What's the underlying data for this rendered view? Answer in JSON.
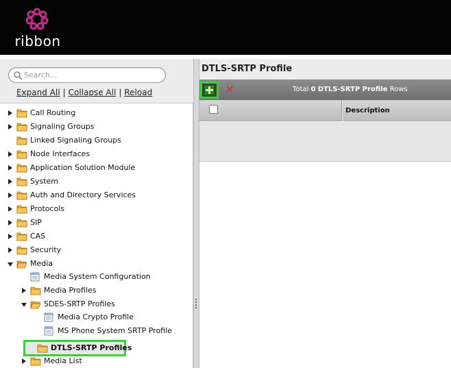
{
  "brand": {
    "name": "ribbon",
    "accent": "#9b2a8f"
  },
  "left": {
    "search": {
      "placeholder": "Search..."
    },
    "links": {
      "expand": "Expand All",
      "collapse": "Collapse All",
      "reload": "Reload"
    },
    "tree": [
      {
        "label": "Call Routing",
        "arrow": "right",
        "icon": "folder",
        "level": 0
      },
      {
        "label": "Signaling Groups",
        "arrow": "right",
        "icon": "folder",
        "level": 0
      },
      {
        "label": "Linked Signaling Groups",
        "arrow": "none",
        "icon": "folder",
        "level": 0
      },
      {
        "label": "Node Interfaces",
        "arrow": "right",
        "icon": "folder",
        "level": 0
      },
      {
        "label": "Application Solution Module",
        "arrow": "right",
        "icon": "folder",
        "level": 0
      },
      {
        "label": "System",
        "arrow": "right",
        "icon": "folder",
        "level": 0
      },
      {
        "label": "Auth and Directory Services",
        "arrow": "right",
        "icon": "folder",
        "level": 0
      },
      {
        "label": "Protocols",
        "arrow": "right",
        "icon": "folder",
        "level": 0
      },
      {
        "label": "SIP",
        "arrow": "right",
        "icon": "folder",
        "level": 0
      },
      {
        "label": "CAS",
        "arrow": "right",
        "icon": "folder",
        "level": 0
      },
      {
        "label": "Security",
        "arrow": "right",
        "icon": "folder",
        "level": 0
      },
      {
        "label": "Media",
        "arrow": "down",
        "icon": "folder-open",
        "level": 0
      },
      {
        "label": "Media System Configuration",
        "arrow": "none",
        "icon": "doc",
        "level": 1
      },
      {
        "label": "Media Profiles",
        "arrow": "right",
        "icon": "folder",
        "level": 1
      },
      {
        "label": "SDES-SRTP Profiles",
        "arrow": "down",
        "icon": "folder-open",
        "level": 1
      },
      {
        "label": "Media Crypto Profile",
        "arrow": "none",
        "icon": "doc",
        "level": 2
      },
      {
        "label": "MS Phone System SRTP Profile",
        "arrow": "none",
        "icon": "doc",
        "level": 2
      },
      {
        "label": "DTLS-SRTP Profiles",
        "arrow": "none",
        "icon": "folder",
        "level": 1,
        "selected": true
      },
      {
        "label": "Media List",
        "arrow": "right",
        "icon": "folder",
        "level": 1
      }
    ]
  },
  "right": {
    "title": "DTLS-SRTP Profile",
    "toolbar": {
      "total_prefix": "Total",
      "total_count": "0",
      "total_name": "DTLS-SRTP Profile",
      "total_suffix": "Rows"
    },
    "grid": {
      "columns": [
        "Description"
      ]
    }
  }
}
